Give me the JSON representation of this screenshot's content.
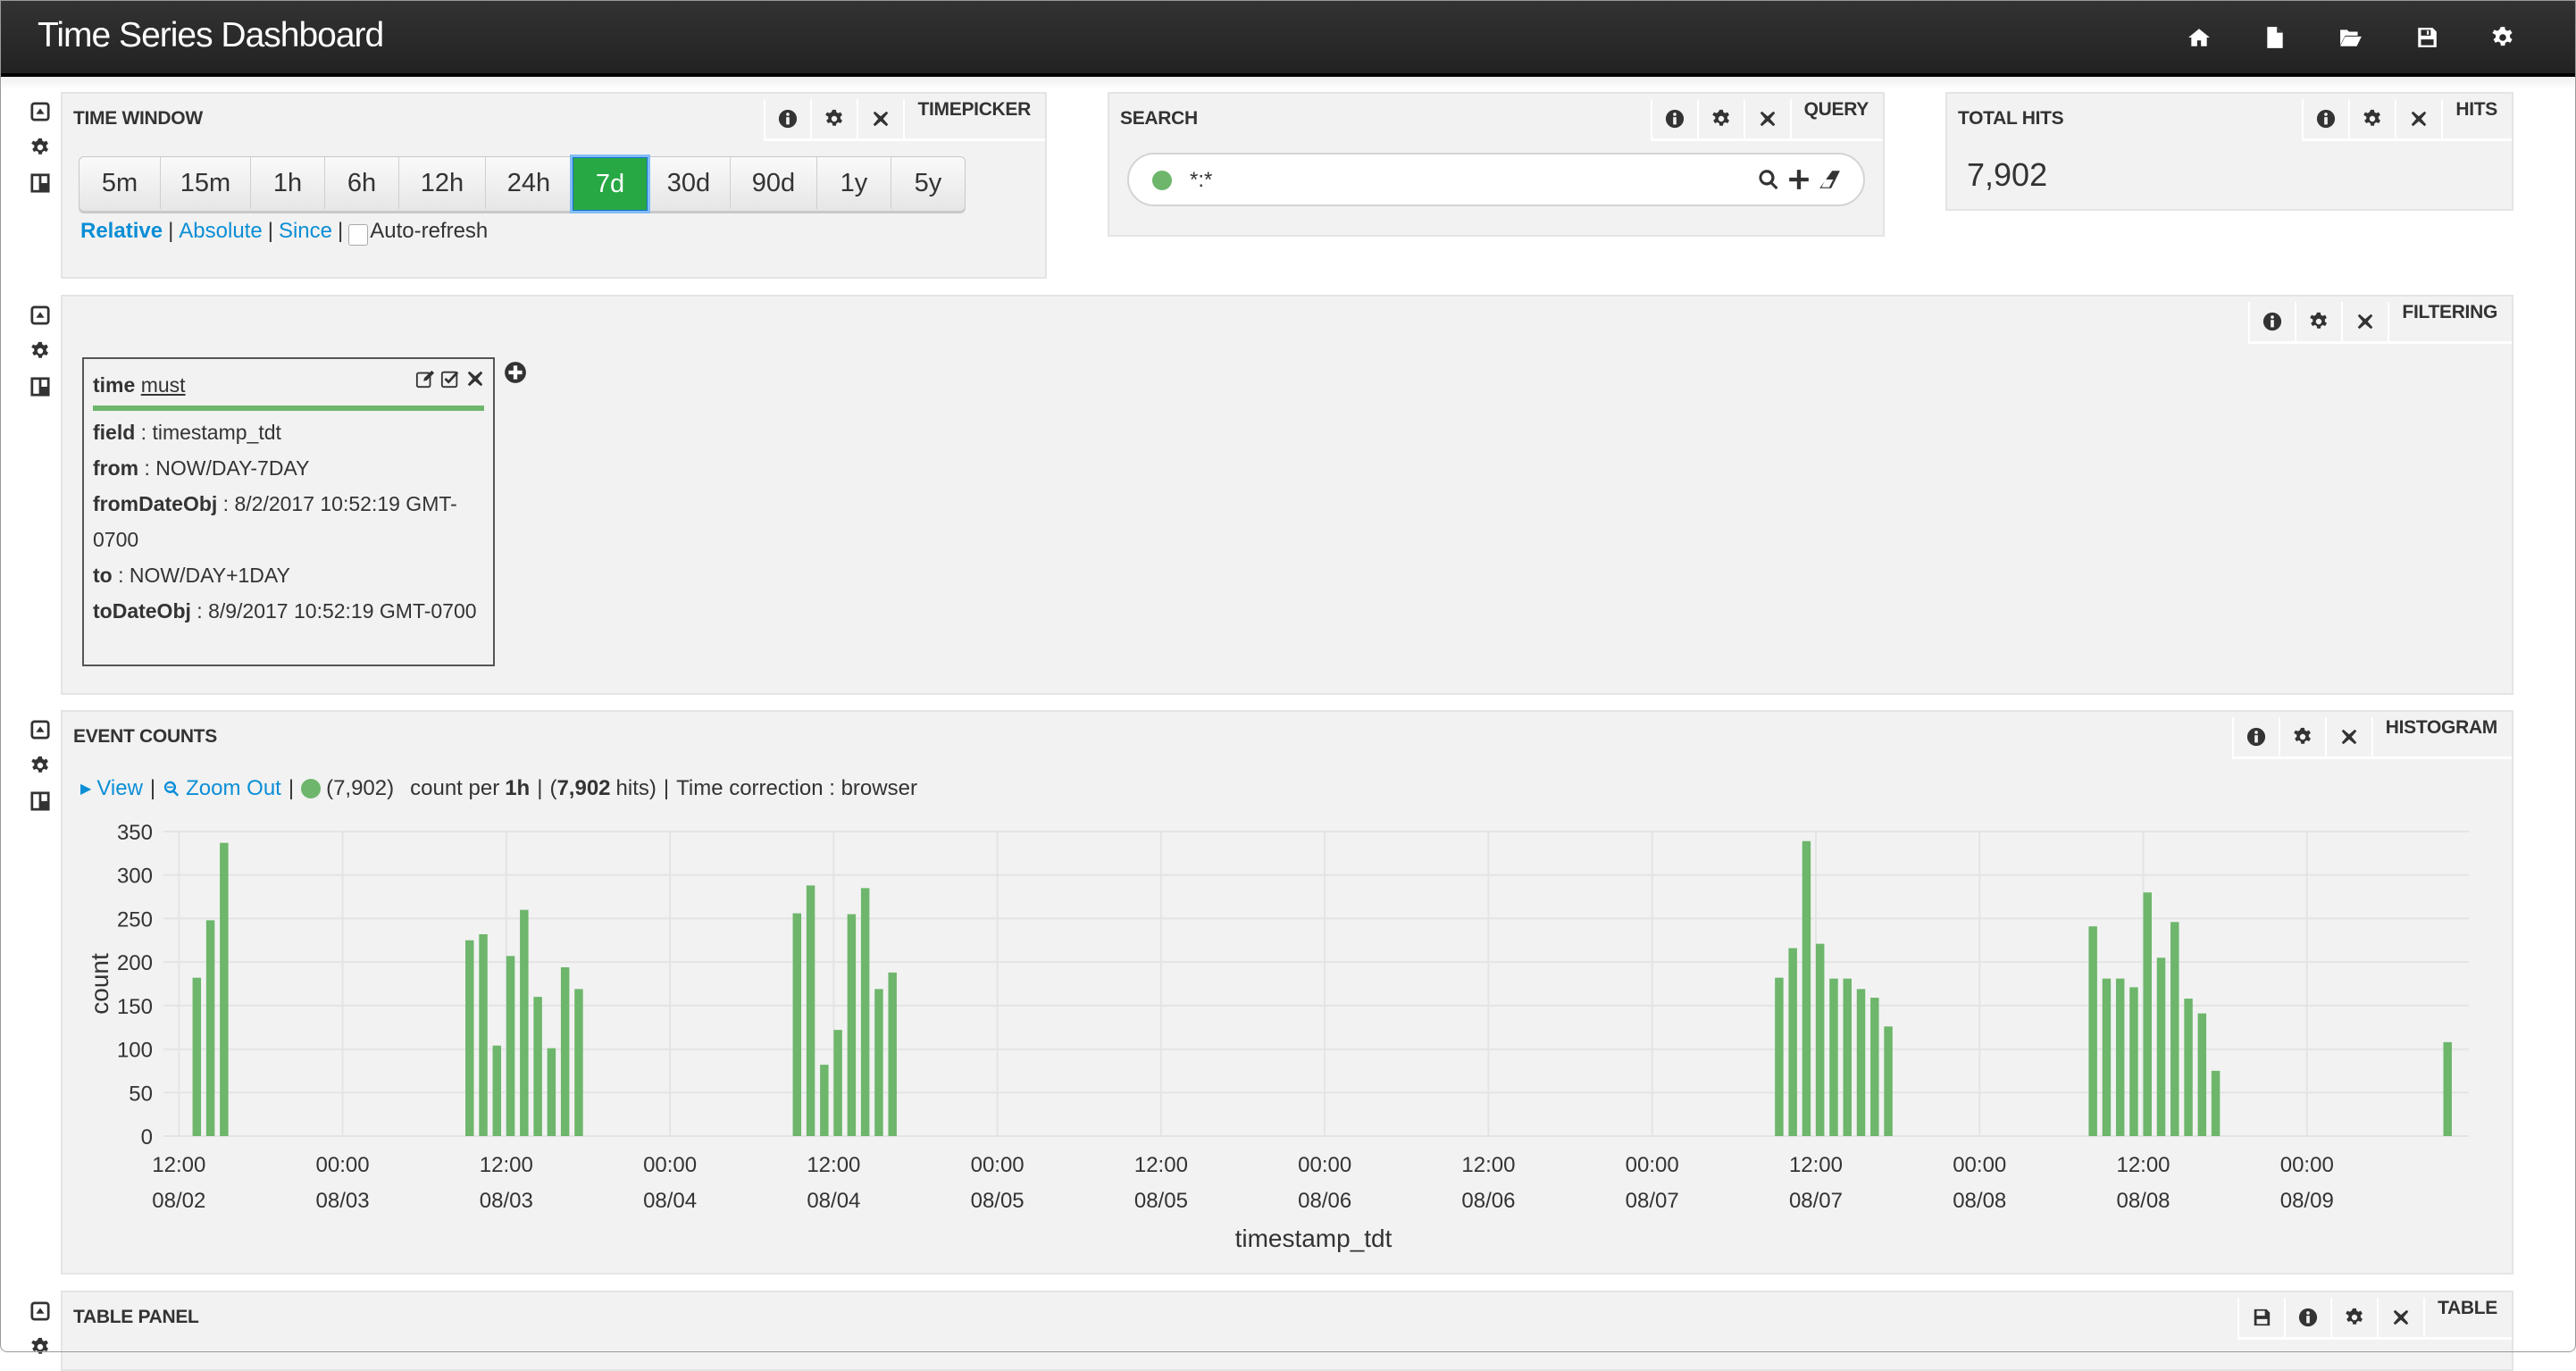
{
  "header": {
    "title": "Time Series Dashboard",
    "nav_icons": [
      "home-icon",
      "new-file-icon",
      "open-folder-icon",
      "save-icon",
      "gear-icon"
    ]
  },
  "timepicker": {
    "title": "TIME WINDOW",
    "type_label": "TIMEPICKER",
    "ranges": [
      "5m",
      "15m",
      "1h",
      "6h",
      "12h",
      "24h",
      "7d",
      "30d",
      "90d",
      "1y",
      "5y"
    ],
    "active_range": "7d",
    "modes": [
      "Relative",
      "Absolute",
      "Since"
    ],
    "active_mode": "Relative",
    "auto_refresh_label": "Auto-refresh",
    "auto_refresh_checked": false
  },
  "search": {
    "title": "SEARCH",
    "type_label": "QUERY",
    "query": "*:*",
    "query_color": "#6db66b"
  },
  "total_hits": {
    "title": "TOTAL HITS",
    "type_label": "HITS",
    "value": "7,902"
  },
  "filtering": {
    "type_label": "FILTERING",
    "filters": [
      {
        "type": "time",
        "mandate": "must",
        "rows": [
          {
            "key": "field",
            "value": "timestamp_tdt"
          },
          {
            "key": "from",
            "value": "NOW/DAY-7DAY"
          },
          {
            "key": "fromDateObj",
            "value": "8/2/2017 10:52:19 GMT-0700"
          },
          {
            "key": "to",
            "value": "NOW/DAY+1DAY"
          },
          {
            "key": "toDateObj",
            "value": "8/9/2017 10:52:19 GMT-0700"
          }
        ]
      }
    ]
  },
  "event_counts": {
    "title": "EVENT COUNTS",
    "type_label": "HISTOGRAM",
    "view_label": "View",
    "zoom_out_label": "Zoom Out",
    "series_count": "(7,902)",
    "count_per_prefix": "count per",
    "interval": "1h",
    "hits_total": "7,902",
    "hits_suffix": "hits)",
    "time_correction": "Time correction : browser"
  },
  "table_panel": {
    "title": "TABLE PANEL",
    "type_label": "TABLE"
  },
  "colors": {
    "accent_green": "#27a844",
    "bar_green": "#6db66b",
    "link_blue": "#0b8ed6",
    "header_bg": "#2a2a2a"
  },
  "chart_data": {
    "type": "bar",
    "title": "",
    "xlabel": "timestamp_tdt",
    "ylabel": "count",
    "ylim": [
      0,
      350
    ],
    "yticks": [
      0,
      50,
      100,
      150,
      200,
      250,
      300,
      350
    ],
    "xlim": [
      "2017-08-02T10:52",
      "2017-08-09T11:52"
    ],
    "interval_hours": 1,
    "grid": true,
    "legend": "none",
    "xticks": [
      {
        "t": "2017-08-02T12:00",
        "time": "12:00",
        "date": "08/02"
      },
      {
        "t": "2017-08-03T00:00",
        "time": "00:00",
        "date": "08/03"
      },
      {
        "t": "2017-08-03T12:00",
        "time": "12:00",
        "date": "08/03"
      },
      {
        "t": "2017-08-04T00:00",
        "time": "00:00",
        "date": "08/04"
      },
      {
        "t": "2017-08-04T12:00",
        "time": "12:00",
        "date": "08/04"
      },
      {
        "t": "2017-08-05T00:00",
        "time": "00:00",
        "date": "08/05"
      },
      {
        "t": "2017-08-05T12:00",
        "time": "12:00",
        "date": "08/05"
      },
      {
        "t": "2017-08-06T00:00",
        "time": "00:00",
        "date": "08/06"
      },
      {
        "t": "2017-08-06T12:00",
        "time": "12:00",
        "date": "08/06"
      },
      {
        "t": "2017-08-07T00:00",
        "time": "00:00",
        "date": "08/07"
      },
      {
        "t": "2017-08-07T12:00",
        "time": "12:00",
        "date": "08/07"
      },
      {
        "t": "2017-08-08T00:00",
        "time": "00:00",
        "date": "08/08"
      },
      {
        "t": "2017-08-08T12:00",
        "time": "12:00",
        "date": "08/08"
      },
      {
        "t": "2017-08-09T00:00",
        "time": "00:00",
        "date": "08/09"
      }
    ],
    "series": [
      {
        "name": "*:*",
        "color": "#6db66b",
        "points": [
          {
            "t": "2017-08-02T13:00",
            "v": 182
          },
          {
            "t": "2017-08-02T14:00",
            "v": 248
          },
          {
            "t": "2017-08-02T15:00",
            "v": 337
          },
          {
            "t": "2017-08-03T09:00",
            "v": 225
          },
          {
            "t": "2017-08-03T10:00",
            "v": 232
          },
          {
            "t": "2017-08-03T11:00",
            "v": 104
          },
          {
            "t": "2017-08-03T12:00",
            "v": 207
          },
          {
            "t": "2017-08-03T13:00",
            "v": 260
          },
          {
            "t": "2017-08-03T14:00",
            "v": 160
          },
          {
            "t": "2017-08-03T15:00",
            "v": 101
          },
          {
            "t": "2017-08-03T16:00",
            "v": 194
          },
          {
            "t": "2017-08-03T17:00",
            "v": 169
          },
          {
            "t": "2017-08-04T09:00",
            "v": 256
          },
          {
            "t": "2017-08-04T10:00",
            "v": 288
          },
          {
            "t": "2017-08-04T11:00",
            "v": 82
          },
          {
            "t": "2017-08-04T12:00",
            "v": 122
          },
          {
            "t": "2017-08-04T13:00",
            "v": 255
          },
          {
            "t": "2017-08-04T14:00",
            "v": 285
          },
          {
            "t": "2017-08-04T15:00",
            "v": 169
          },
          {
            "t": "2017-08-04T16:00",
            "v": 188
          },
          {
            "t": "2017-08-07T09:00",
            "v": 182
          },
          {
            "t": "2017-08-07T10:00",
            "v": 216
          },
          {
            "t": "2017-08-07T11:00",
            "v": 339
          },
          {
            "t": "2017-08-07T12:00",
            "v": 221
          },
          {
            "t": "2017-08-07T13:00",
            "v": 181
          },
          {
            "t": "2017-08-07T14:00",
            "v": 181
          },
          {
            "t": "2017-08-07T15:00",
            "v": 169
          },
          {
            "t": "2017-08-07T16:00",
            "v": 159
          },
          {
            "t": "2017-08-07T17:00",
            "v": 126
          },
          {
            "t": "2017-08-08T08:00",
            "v": 241
          },
          {
            "t": "2017-08-08T09:00",
            "v": 181
          },
          {
            "t": "2017-08-08T10:00",
            "v": 181
          },
          {
            "t": "2017-08-08T11:00",
            "v": 171
          },
          {
            "t": "2017-08-08T12:00",
            "v": 280
          },
          {
            "t": "2017-08-08T13:00",
            "v": 205
          },
          {
            "t": "2017-08-08T14:00",
            "v": 246
          },
          {
            "t": "2017-08-08T15:00",
            "v": 158
          },
          {
            "t": "2017-08-08T16:00",
            "v": 141
          },
          {
            "t": "2017-08-08T17:00",
            "v": 75
          },
          {
            "t": "2017-08-09T10:00",
            "v": 108
          }
        ]
      }
    ]
  }
}
